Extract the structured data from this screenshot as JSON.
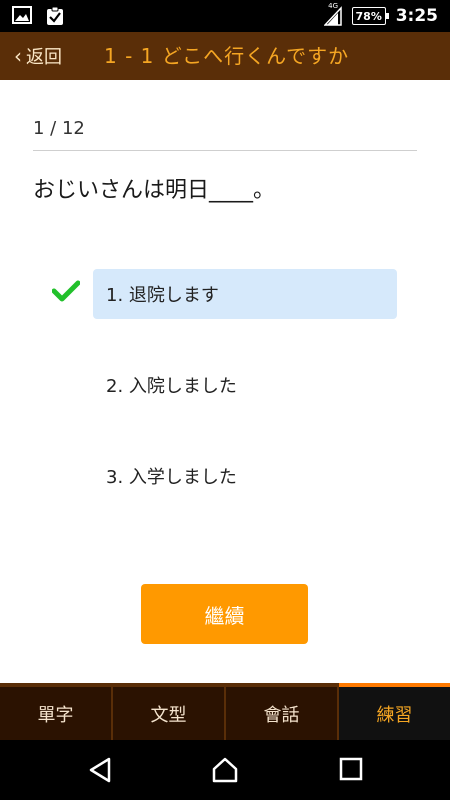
{
  "status_bar": {
    "network": "4G",
    "battery": "78%",
    "time": "3:25",
    "icons": [
      "image-icon",
      "clipboard-check-icon",
      "signal-icon",
      "battery-icon"
    ]
  },
  "header": {
    "back_label": "返回",
    "back_icon": "chevron-left-icon",
    "title": "1 - 1 どこへ行くんですか",
    "background_color": "#5a2e08",
    "title_color": "#f5a623"
  },
  "quiz": {
    "progress": "1 / 12",
    "question": "おじいさんは明日____。",
    "options": [
      {
        "label": "1. 退院します",
        "selected": true
      },
      {
        "label": "2. 入院しました",
        "selected": false
      },
      {
        "label": "3. 入学しました",
        "selected": false
      }
    ],
    "selected_highlight_color": "#d6e9fb",
    "check_color": "#22c02b",
    "continue_label": "繼續",
    "continue_color": "#ff9900"
  },
  "tabs": [
    {
      "label": "單字",
      "active": false
    },
    {
      "label": "文型",
      "active": false
    },
    {
      "label": "會話",
      "active": false
    },
    {
      "label": "練習",
      "active": true
    }
  ],
  "nav_bar": {
    "icons": [
      "back-triangle-icon",
      "home-icon",
      "recent-apps-icon"
    ]
  }
}
